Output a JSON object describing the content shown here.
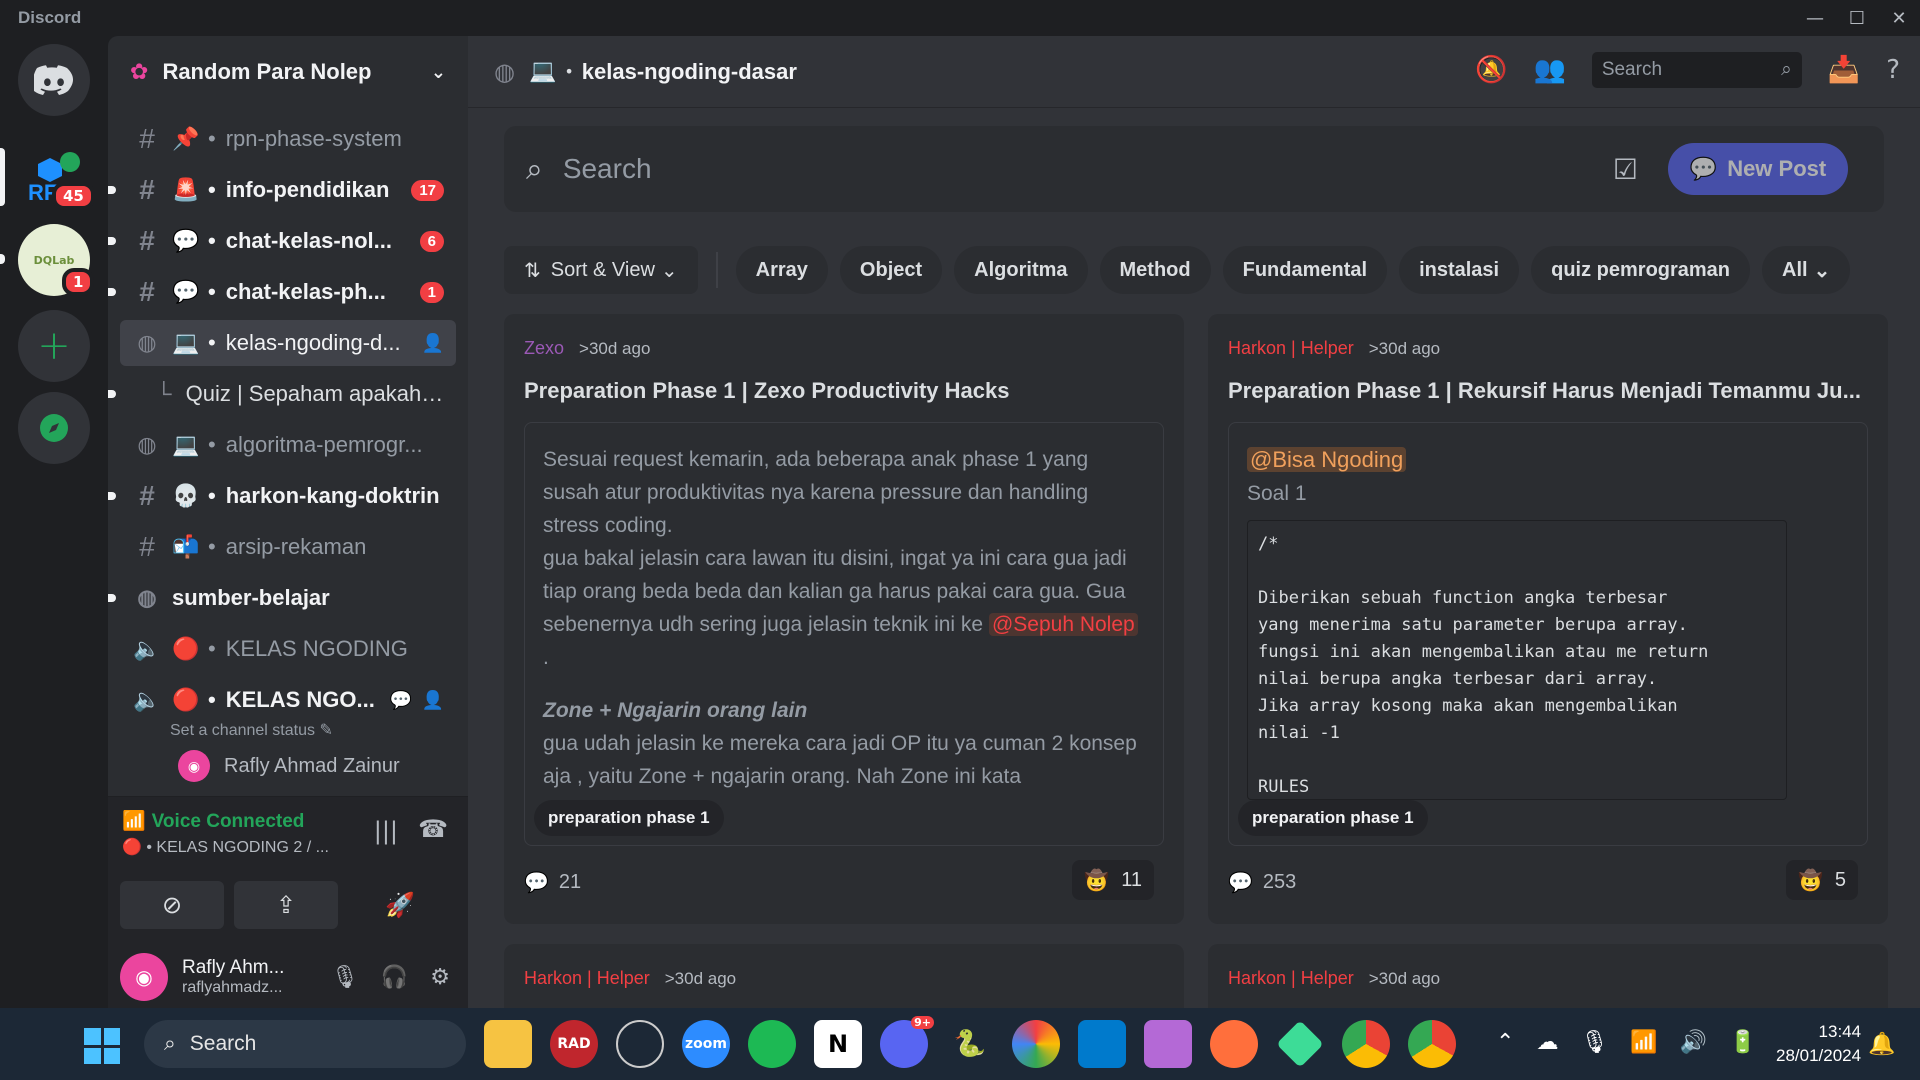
{
  "window": {
    "title": "Discord",
    "controls": [
      "—",
      "☐",
      "✕"
    ]
  },
  "rail": {
    "rf_badge": "45",
    "dq_badge": "1",
    "dq_label": "DQLab"
  },
  "server": {
    "name": "Random Para Nolep"
  },
  "channels": [
    {
      "type": "text",
      "emoji": "📌",
      "name": "rpn-phase-system",
      "unread": false,
      "count": ""
    },
    {
      "type": "text",
      "emoji": "🚨",
      "name": "info-pendidikan",
      "unread": true,
      "count": "17"
    },
    {
      "type": "text",
      "emoji": "💬",
      "name": "chat-kelas-nol...",
      "unread": true,
      "count": "6"
    },
    {
      "type": "text",
      "emoji": "💬",
      "name": "chat-kelas-ph...",
      "unread": true,
      "count": "1"
    },
    {
      "type": "forum",
      "emoji": "💻",
      "name": "kelas-ngoding-d...",
      "active": true
    },
    {
      "type": "thread",
      "name": "Quiz | Sepaham apakah ..."
    },
    {
      "type": "forum",
      "emoji": "💻",
      "name": "algoritma-pemrogr...",
      "unread": false
    },
    {
      "type": "text",
      "emoji": "💀",
      "name": "harkon-kang-doktrin",
      "unread": true
    },
    {
      "type": "text",
      "emoji": "📬",
      "name": "arsip-rekaman",
      "unread": false
    },
    {
      "type": "forum",
      "emoji": "",
      "name": "sumber-belajar",
      "unread": true
    },
    {
      "type": "voice",
      "emoji": "🔴",
      "name": "KELAS NGODING",
      "unread": false
    },
    {
      "type": "voice",
      "emoji": "🔴",
      "name": "KELAS NGO...",
      "unread": true
    }
  ],
  "voice_channel_status": "Set a channel status",
  "voice_user": "Rafly Ahmad Zainur",
  "voice_panel": {
    "status": "Voice Connected",
    "channel": "KELAS NGODING 2 / ..."
  },
  "user": {
    "name": "Rafly Ahm...",
    "tag": "raflyahmadz..."
  },
  "topbar": {
    "channel": "kelas-ngoding-dasar",
    "search_placeholder": "Search"
  },
  "forum": {
    "search_placeholder": "Search",
    "new_post": "New Post",
    "sort_label": "Sort & View",
    "tags": [
      "Array",
      "Object",
      "Algoritma",
      "Method",
      "Fundamental",
      "instalasi",
      "quiz pemrograman"
    ],
    "all_label": "All"
  },
  "posts": [
    {
      "author": "Zexo",
      "author_color": "#9b59b6",
      "time": ">30d ago",
      "title": "Preparation Phase 1 | Zexo Productivity Hacks",
      "body_1": "Sesuai request kemarin, ada beberapa anak phase 1 yang susah atur produktivitas nya karena pressure dan handling stress coding.",
      "body_2": "gua bakal jelasin cara lawan itu disini, ingat ya ini cara gua jadi tiap orang beda beda dan kalian ga harus pakai cara gua. Gua sebenernya udh sering juga jelasin teknik ini ke",
      "mention": "@Sepuh Nolep",
      "body_3": ".",
      "subheading": "Zone + Ngajarin orang lain",
      "body_4": "gua udah jelasin ke mereka cara jadi OP itu ya cuman 2 konsep aja , yaitu  Zone + ngajarin orang. Nah Zone ini kata",
      "tag": "preparation phase 1",
      "replies": "21",
      "reactions": "11"
    },
    {
      "author": "Harkon | Helper",
      "author_color": "#f23f43",
      "time": ">30d ago",
      "title": "Preparation Phase 1 | Rekursif Harus Menjadi Temanmu Ju...",
      "mention": "@Bisa Ngoding",
      "subtitle": "Soal 1",
      "code": "/*\n\nDiberikan sebuah function angka terbesar\nyang menerima satu parameter berupa array.\nfungsi ini akan mengembalikan atau me return\nnilai berupa angka terbesar dari array.\nJika array kosong maka akan mengembalikan\nnilai -1\n\nRULES",
      "tag": "preparation phase 1",
      "replies": "253",
      "reactions": "5"
    },
    {
      "author": "Harkon | Helper",
      "author_color": "#f23f43",
      "time": ">30d ago"
    },
    {
      "author": "Harkon | Helper",
      "author_color": "#f23f43",
      "time": ">30d ago"
    }
  ],
  "taskbar": {
    "search": "Search",
    "time": "13:44",
    "date": "28/01/2024",
    "discord_badge": "9+"
  }
}
